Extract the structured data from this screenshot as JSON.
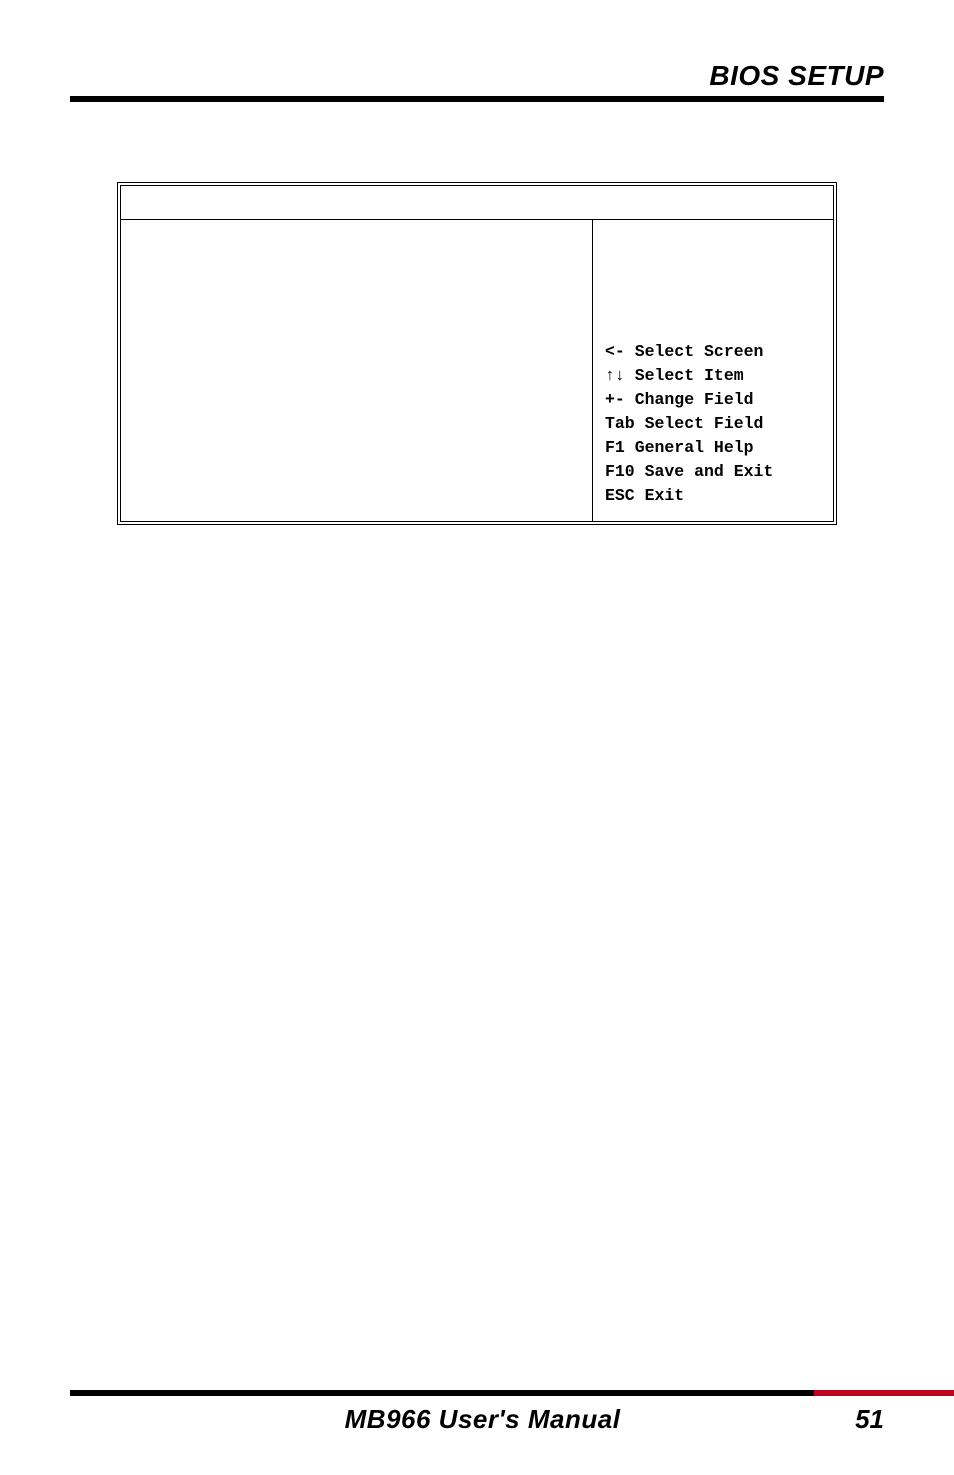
{
  "header": {
    "title": "BIOS SETUP"
  },
  "bios": {
    "help": {
      "select_screen": "<-  Select Screen",
      "select_item": "↑↓ Select Item",
      "change_field": "+-  Change Field",
      "select_field": "Tab Select Field",
      "general_help": "F1  General Help",
      "save_exit": "F10 Save and Exit",
      "exit": "ESC Exit"
    }
  },
  "footer": {
    "manual": "MB966 User's Manual",
    "page": "51"
  }
}
